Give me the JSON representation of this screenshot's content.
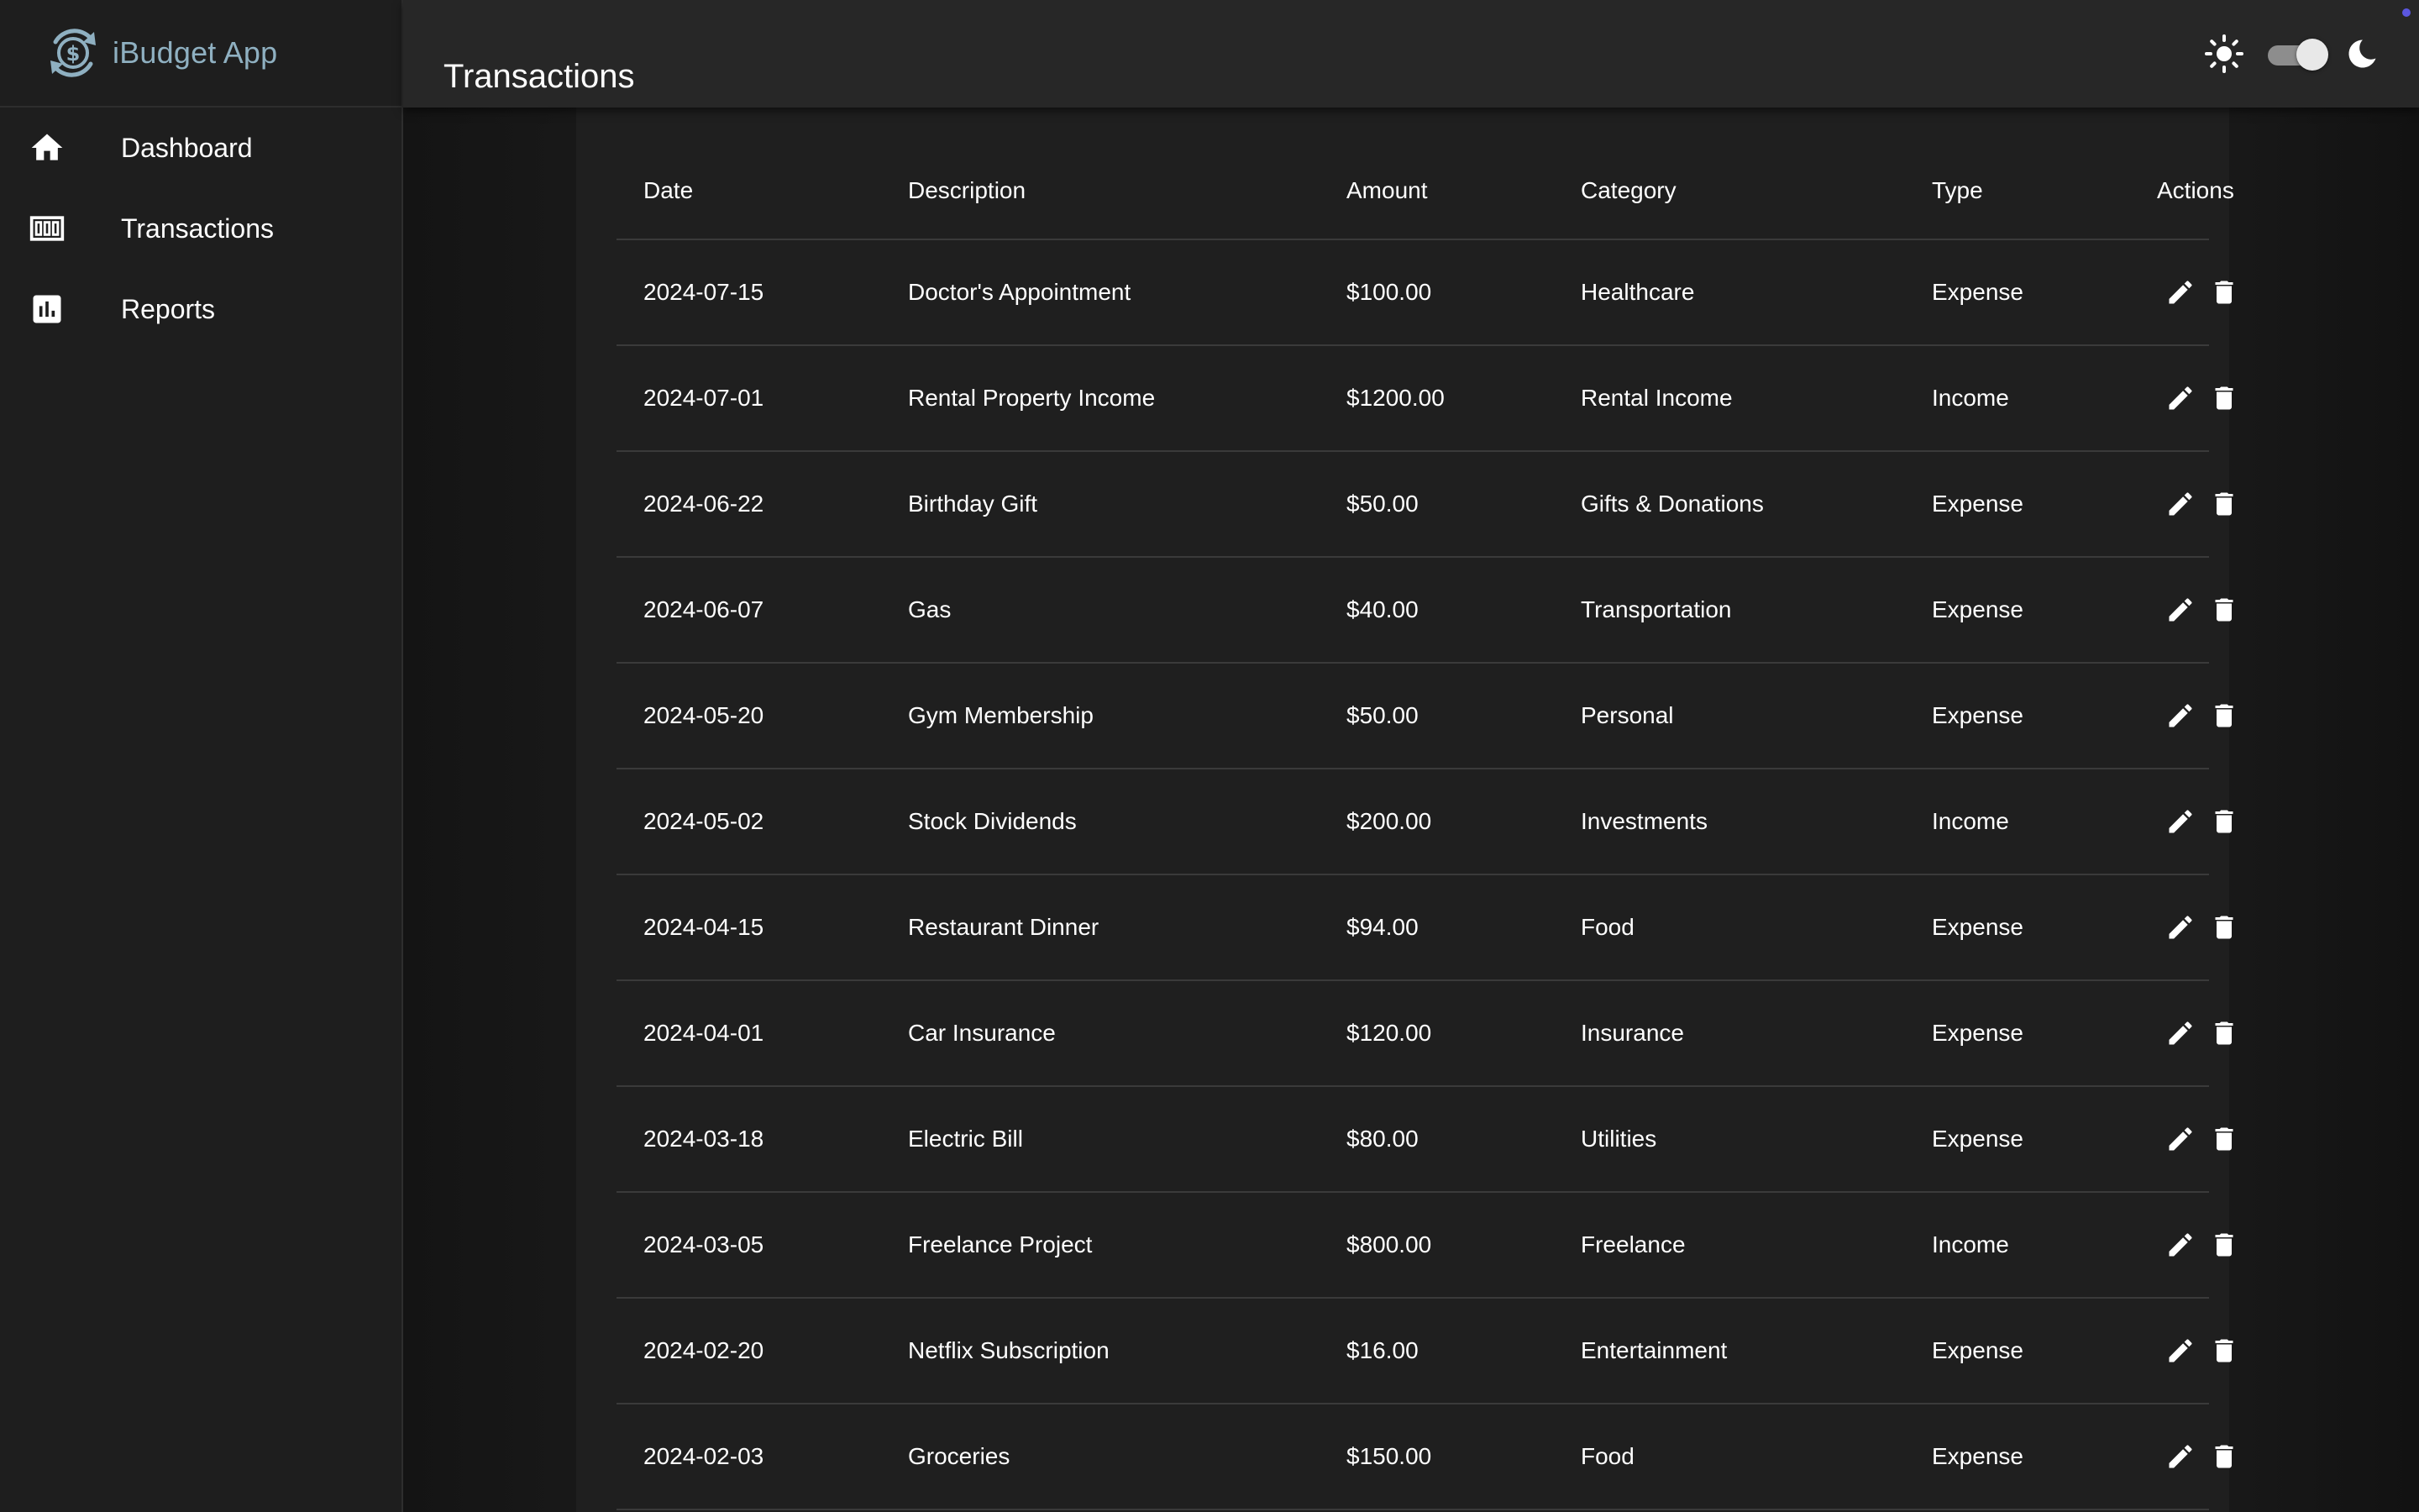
{
  "app": {
    "name": "iBudget App"
  },
  "sidebar": {
    "items": [
      {
        "label": "Dashboard",
        "icon": "home-icon"
      },
      {
        "label": "Transactions",
        "icon": "transactions-icon"
      },
      {
        "label": "Reports",
        "icon": "bar-chart-icon"
      }
    ]
  },
  "header": {
    "title": "Transactions",
    "theme_toggle": {
      "light_icon": "sun-icon",
      "dark_icon": "moon-icon",
      "dark_mode": true
    }
  },
  "colors": {
    "brand": "#8fb0c1",
    "sidebar_bg": "#1e1e1e",
    "header_bg": "#272727",
    "card_bg": "#1f1f1f",
    "accent_dot": "#5b57e0"
  },
  "table": {
    "headers": [
      "Date",
      "Description",
      "Amount",
      "Category",
      "Type",
      "Actions"
    ],
    "rows": [
      {
        "date": "2024-07-15",
        "description": "Doctor's Appointment",
        "amount": "$100.00",
        "category": "Healthcare",
        "type": "Expense"
      },
      {
        "date": "2024-07-01",
        "description": "Rental Property Income",
        "amount": "$1200.00",
        "category": "Rental Income",
        "type": "Income"
      },
      {
        "date": "2024-06-22",
        "description": "Birthday Gift",
        "amount": "$50.00",
        "category": "Gifts & Donations",
        "type": "Expense"
      },
      {
        "date": "2024-06-07",
        "description": "Gas",
        "amount": "$40.00",
        "category": "Transportation",
        "type": "Expense"
      },
      {
        "date": "2024-05-20",
        "description": "Gym Membership",
        "amount": "$50.00",
        "category": "Personal",
        "type": "Expense"
      },
      {
        "date": "2024-05-02",
        "description": "Stock Dividends",
        "amount": "$200.00",
        "category": "Investments",
        "type": "Income"
      },
      {
        "date": "2024-04-15",
        "description": "Restaurant Dinner",
        "amount": "$94.00",
        "category": "Food",
        "type": "Expense"
      },
      {
        "date": "2024-04-01",
        "description": "Car Insurance",
        "amount": "$120.00",
        "category": "Insurance",
        "type": "Expense"
      },
      {
        "date": "2024-03-18",
        "description": "Electric Bill",
        "amount": "$80.00",
        "category": "Utilities",
        "type": "Expense"
      },
      {
        "date": "2024-03-05",
        "description": "Freelance Project",
        "amount": "$800.00",
        "category": "Freelance",
        "type": "Income"
      },
      {
        "date": "2024-02-20",
        "description": "Netflix Subscription",
        "amount": "$16.00",
        "category": "Entertainment",
        "type": "Expense"
      },
      {
        "date": "2024-02-03",
        "description": "Groceries",
        "amount": "$150.00",
        "category": "Food",
        "type": "Expense"
      }
    ],
    "row_actions": [
      "edit-icon",
      "delete-icon"
    ]
  }
}
